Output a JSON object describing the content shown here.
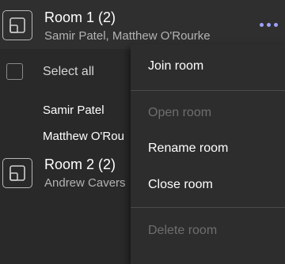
{
  "rooms": [
    {
      "title": "Room 1 (2)",
      "members": "Samir Patel, Matthew O'Rourke",
      "icon": "breakout-room-icon"
    },
    {
      "title": "Room 2 (2)",
      "members": "Andrew Cavers",
      "icon": "breakout-room-icon"
    }
  ],
  "select_all_label": "Select all",
  "participants": [
    "Samir Patel",
    "Matthew O'Rou"
  ],
  "more_icon": "more-options-icon",
  "context_menu": {
    "items": [
      {
        "label": "Join room",
        "enabled": true
      },
      {
        "label": "Open room",
        "enabled": false
      },
      {
        "label": "Rename room",
        "enabled": true
      },
      {
        "label": "Close room",
        "enabled": true
      },
      {
        "label": "Delete room",
        "enabled": false
      }
    ]
  },
  "colors": {
    "background": "#292929",
    "menu_background": "#2d2d2d",
    "accent_dots": "#9ea2ff",
    "disabled_text": "#6e6e6e",
    "secondary_text": "#b3b3b3"
  }
}
